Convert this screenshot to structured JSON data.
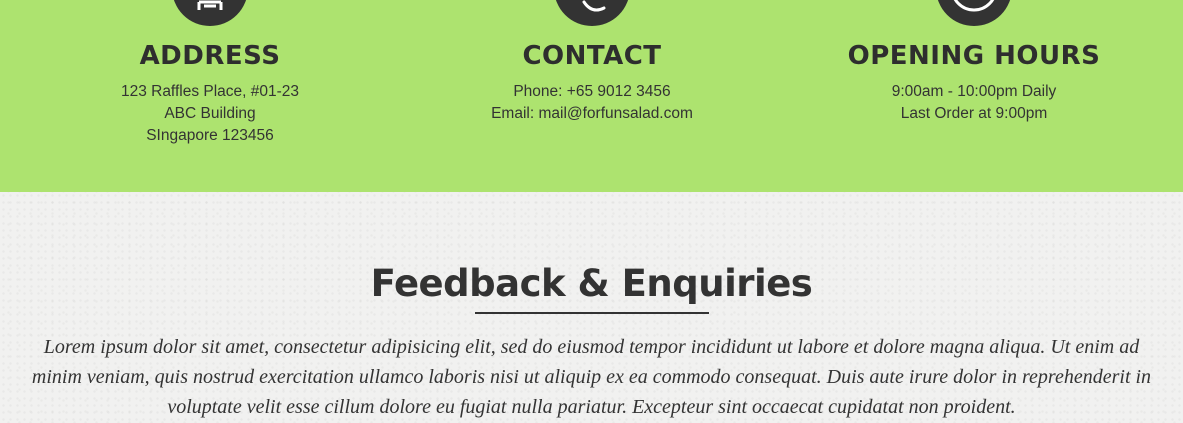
{
  "info": {
    "address": {
      "icon": "building-icon",
      "title": "ADDRESS",
      "lines": [
        "123 Raffles Place, #01-23",
        "ABC Building",
        "SIngapore 123456"
      ]
    },
    "contact": {
      "icon": "phone-icon",
      "title": "CONTACT",
      "lines": [
        "Phone: +65 9012 3456",
        "Email: mail@forfunsalad.com"
      ]
    },
    "hours": {
      "icon": "clock-icon",
      "title": "OPENING HOURS",
      "lines": [
        "9:00am - 10:00pm Daily",
        "Last Order at 9:00pm"
      ]
    }
  },
  "feedback": {
    "title": "Feedback & Enquiries",
    "body": "Lorem ipsum dolor sit amet, consectetur adipisicing elit, sed do eiusmod tempor incididunt ut labore et dolore magna aliqua. Ut enim ad minim veniam, quis nostrud exercitation ullamco laboris nisi ut aliquip ex ea commodo consequat. Duis aute irure dolor in reprehenderit in voluptate velit esse cillum dolore eu fugiat nulla pariatur. Excepteur sint occaecat cupidatat non proident."
  },
  "colors": {
    "band_green": "#ade36f",
    "icon_dark": "#333333",
    "text_dark": "#333333",
    "feedback_bg": "#f1f1f0"
  }
}
